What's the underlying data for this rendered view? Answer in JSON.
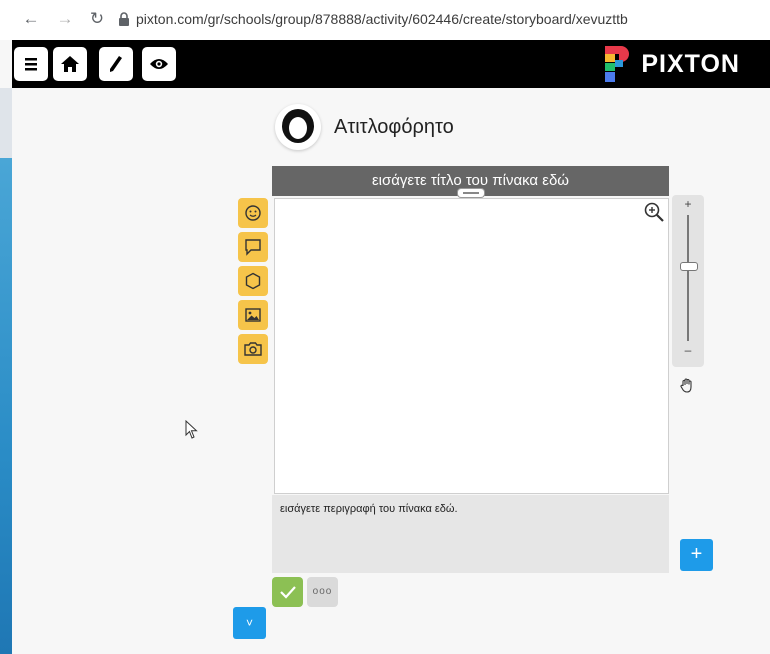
{
  "browser": {
    "back_icon": "←",
    "forward_icon": "→",
    "reload_icon": "↻",
    "url": "pixton.com/gr/schools/group/878888/activity/602446/create/storyboard/xevuzttb"
  },
  "app_bar": {
    "logo_text": "PIXTON",
    "tools": [
      "menu-icon",
      "home-icon",
      "pencil-icon",
      "eye-icon"
    ]
  },
  "comic": {
    "title": "Ατιτλοφόρητο",
    "panel_title_placeholder": "εισάγετε τίτλο του πίνακα εδώ",
    "panel_description_placeholder": "εισάγετε περιγραφή του πίνακα εδώ."
  },
  "palette": [
    "character-icon",
    "speech-bubble-icon",
    "prop-icon",
    "image-icon",
    "camera-icon"
  ],
  "zoom": {
    "plus_label": "+",
    "minus_label": "–",
    "level": 0.6
  },
  "buttons": {
    "add_panel_label": "+",
    "more_label": "ooo",
    "collapse_label": "˅"
  },
  "colors": {
    "palette_yellow": "#f6c44a",
    "accent_blue": "#1e9be9",
    "confirm_green": "#8cc054",
    "header_gray": "#666666"
  }
}
